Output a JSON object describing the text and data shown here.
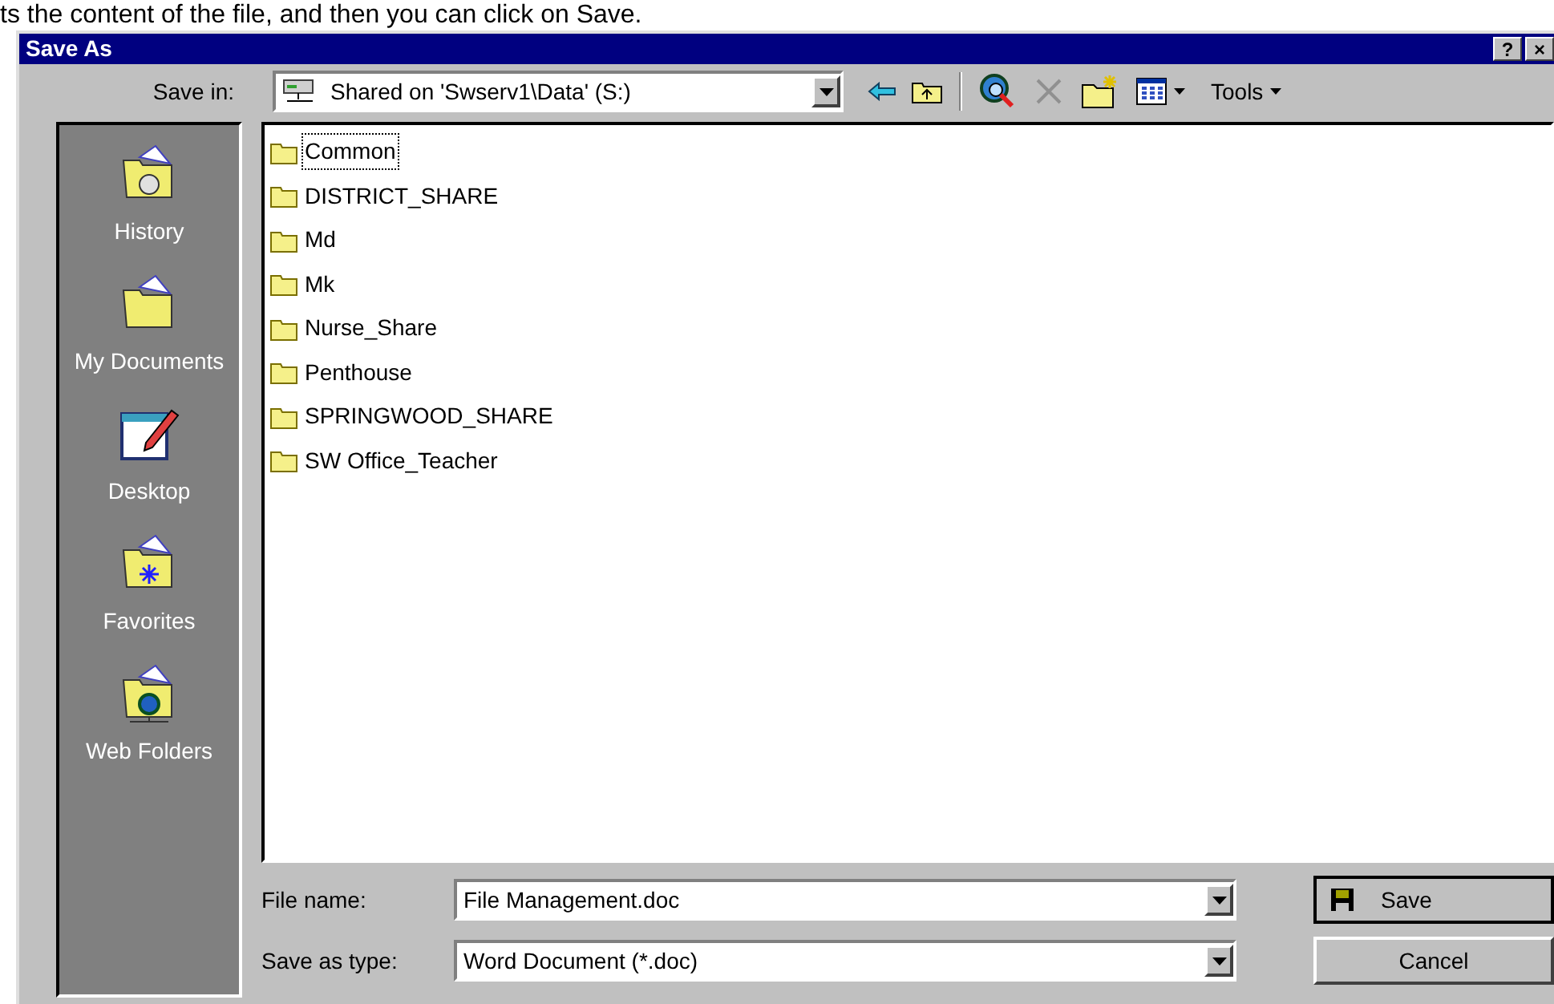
{
  "caption": "ts the content of the file, and then you can click on Save.",
  "dialog": {
    "title": "Save As",
    "title_buttons": [
      "?",
      "×"
    ]
  },
  "save_in": {
    "label": "Save in:",
    "value": "Shared on 'Swserv1\\Data' (S:)"
  },
  "toolbar": [
    {
      "kind": "back",
      "disabled": false
    },
    {
      "kind": "up",
      "disabled": false
    },
    {
      "kind": "separator"
    },
    {
      "kind": "search-web",
      "disabled": false
    },
    {
      "kind": "delete",
      "disabled": true
    },
    {
      "kind": "new-folder",
      "disabled": false
    },
    {
      "kind": "views",
      "disabled": false
    },
    {
      "kind": "menu",
      "label": "Tools",
      "disabled": false
    }
  ],
  "places": [
    {
      "label": "History",
      "kind": "history"
    },
    {
      "label": "My Documents",
      "kind": "documents"
    },
    {
      "label": "Desktop",
      "kind": "desktop"
    },
    {
      "label": "Favorites",
      "kind": "favorites"
    },
    {
      "label": "Web Folders",
      "kind": "web"
    }
  ],
  "files": [
    {
      "name": "Common",
      "selected": true
    },
    {
      "name": "DISTRICT_SHARE",
      "selected": false
    },
    {
      "name": "Md",
      "selected": false
    },
    {
      "name": "Mk",
      "selected": false
    },
    {
      "name": "Nurse_Share",
      "selected": false
    },
    {
      "name": "Penthouse",
      "selected": false
    },
    {
      "name": "SPRINGWOOD_SHARE",
      "selected": false
    },
    {
      "name": "SW Office_Teacher",
      "selected": false
    }
  ],
  "file_name": {
    "label": "File name:",
    "value": "File Management.doc"
  },
  "save_as_type": {
    "label": "Save as type:",
    "value": "Word Document (*.doc)"
  },
  "buttons": [
    {
      "label": "Save",
      "kind": "save"
    },
    {
      "label": "Cancel",
      "kind": "cancel"
    }
  ]
}
